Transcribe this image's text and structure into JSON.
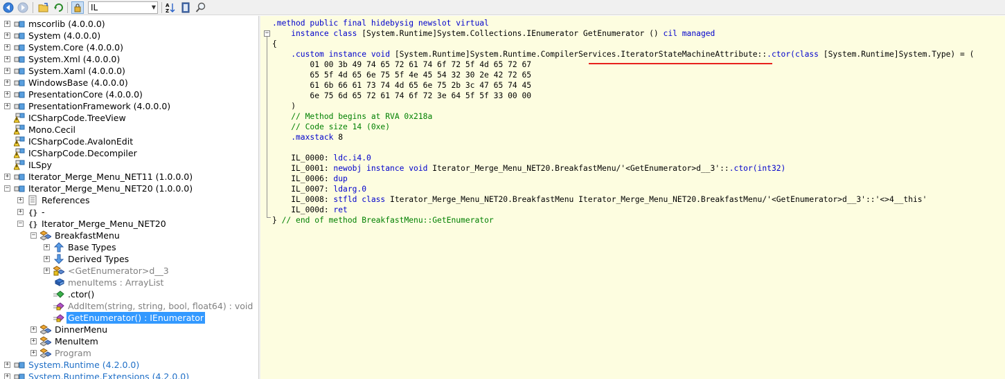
{
  "toolbar": {
    "language": "IL",
    "buttons": [
      "back-icon",
      "forward-icon",
      "open-file-icon",
      "reload-icon",
      "show-internal-icon",
      "sort-icon",
      "documentation-icon",
      "search-icon"
    ]
  },
  "tree": {
    "items": [
      {
        "label": "mscorlib (4.0.0.0)",
        "expander": "+",
        "icon": "assembly-icon",
        "style": "normal"
      },
      {
        "label": "System (4.0.0.0)",
        "expander": "+",
        "icon": "assembly-icon",
        "style": "normal"
      },
      {
        "label": "System.Core (4.0.0.0)",
        "expander": "+",
        "icon": "assembly-icon",
        "style": "normal"
      },
      {
        "label": "System.Xml (4.0.0.0)",
        "expander": "+",
        "icon": "assembly-icon",
        "style": "normal"
      },
      {
        "label": "System.Xaml (4.0.0.0)",
        "expander": "+",
        "icon": "assembly-icon",
        "style": "normal"
      },
      {
        "label": "WindowsBase (4.0.0.0)",
        "expander": "+",
        "icon": "assembly-icon",
        "style": "normal"
      },
      {
        "label": "PresentationCore (4.0.0.0)",
        "expander": "+",
        "icon": "assembly-icon",
        "style": "normal"
      },
      {
        "label": "PresentationFramework (4.0.0.0)",
        "expander": "+",
        "icon": "assembly-icon",
        "style": "normal"
      },
      {
        "label": "ICSharpCode.TreeView",
        "expander": "",
        "icon": "assembly-warning-icon",
        "style": "normal"
      },
      {
        "label": "Mono.Cecil",
        "expander": "",
        "icon": "assembly-warning-icon",
        "style": "normal"
      },
      {
        "label": "ICSharpCode.AvalonEdit",
        "expander": "",
        "icon": "assembly-warning-icon",
        "style": "normal"
      },
      {
        "label": "ICSharpCode.Decompiler",
        "expander": "",
        "icon": "assembly-warning-icon",
        "style": "normal"
      },
      {
        "label": "ILSpy",
        "expander": "",
        "icon": "assembly-warning-icon",
        "style": "normal"
      },
      {
        "label": "Iterator_Merge_Menu_NET11 (1.0.0.0)",
        "expander": "+",
        "icon": "assembly-icon",
        "style": "normal"
      },
      {
        "label": "Iterator_Merge_Menu_NET20 (1.0.0.0)",
        "expander": "-",
        "icon": "assembly-icon",
        "style": "normal"
      },
      {
        "label": "References",
        "expander": "+",
        "icon": "references-icon",
        "style": "normal"
      },
      {
        "label": "-",
        "expander": "+",
        "icon": "namespace-icon",
        "style": "normal"
      },
      {
        "label": "Iterator_Merge_Menu_NET20",
        "expander": "-",
        "icon": "namespace-icon",
        "style": "normal"
      },
      {
        "label": "BreakfastMenu",
        "expander": "-",
        "icon": "class-icon",
        "style": "normal"
      },
      {
        "label": "Base Types",
        "expander": "+",
        "icon": "base-types-icon",
        "style": "normal"
      },
      {
        "label": "Derived Types",
        "expander": "+",
        "icon": "derived-types-icon",
        "style": "normal"
      },
      {
        "label": "<GetEnumerator>d__3",
        "expander": "+",
        "icon": "nested-class-icon",
        "style": "gray"
      },
      {
        "label": "menuItems : ArrayList",
        "expander": "",
        "icon": "field-icon",
        "style": "gray"
      },
      {
        "label": ".ctor()",
        "expander": "",
        "icon": "method-icon",
        "style": "normal"
      },
      {
        "label": "AddItem(string, string, bool, float64) : void",
        "expander": "",
        "icon": "method-private-icon",
        "style": "gray"
      },
      {
        "label": "GetEnumerator() : IEnumerator",
        "expander": "",
        "icon": "method-private-icon",
        "style": "selected"
      },
      {
        "label": "DinnerMenu",
        "expander": "+",
        "icon": "class-icon",
        "style": "normal"
      },
      {
        "label": "MenuItem",
        "expander": "+",
        "icon": "class-icon",
        "style": "normal"
      },
      {
        "label": "Program",
        "expander": "+",
        "icon": "class-icon",
        "style": "gray"
      },
      {
        "label": "System.Runtime (4.2.0.0)",
        "expander": "+",
        "icon": "assembly-icon",
        "style": "blue"
      },
      {
        "label": "System.Runtime.Extensions (4.2.0.0)",
        "expander": "+",
        "icon": "assembly-icon",
        "style": "blue"
      }
    ]
  },
  "code": {
    "lines": [
      [
        {
          "t": ".method public final hidebysig newslot virtual",
          "k": "kw"
        }
      ],
      [
        {
          "t": "    instance class ",
          "k": "kw"
        },
        {
          "t": "[System.Runtime]System.Collections.IEnumerator GetEnumerator () ",
          "k": ""
        },
        {
          "t": "cil managed",
          "k": "kw"
        }
      ],
      [
        {
          "t": "{",
          "k": ""
        }
      ],
      [
        {
          "t": "    .custom instance void ",
          "k": "kw"
        },
        {
          "t": "[System.Runtime]System.Runtime.CompilerServices.IteratorStateMachineAttribute::",
          "k": ""
        },
        {
          "t": ".ctor(class ",
          "k": "kw"
        },
        {
          "t": "[System.Runtime]System.Type) = (",
          "k": ""
        }
      ],
      [
        {
          "t": "        01 00 3b 49 74 65 72 61 74 6f 72 5f 4d 65 72 67",
          "k": ""
        }
      ],
      [
        {
          "t": "        65 5f 4d 65 6e 75 5f 4e 45 54 32 30 2e 42 72 65",
          "k": ""
        }
      ],
      [
        {
          "t": "        61 6b 66 61 73 74 4d 65 6e 75 2b 3c 47 65 74 45",
          "k": ""
        }
      ],
      [
        {
          "t": "        6e 75 6d 65 72 61 74 6f 72 3e 64 5f 5f 33 00 00",
          "k": ""
        }
      ],
      [
        {
          "t": "    )",
          "k": ""
        }
      ],
      [
        {
          "t": "    // Method begins at RVA 0x218a",
          "k": "cm"
        }
      ],
      [
        {
          "t": "    // Code size 14 (0xe)",
          "k": "cm"
        }
      ],
      [
        {
          "t": "    .maxstack ",
          "k": "kw"
        },
        {
          "t": "8",
          "k": ""
        }
      ],
      [
        {
          "t": "",
          "k": ""
        }
      ],
      [
        {
          "t": "    IL_0000: ",
          "k": ""
        },
        {
          "t": "ldc.i4.0",
          "k": "kw"
        }
      ],
      [
        {
          "t": "    IL_0001: ",
          "k": ""
        },
        {
          "t": "newobj instance void ",
          "k": "kw"
        },
        {
          "t": "Iterator_Merge_Menu_NET20.BreakfastMenu/'<GetEnumerator>d__3'::",
          "k": ""
        },
        {
          "t": ".ctor(int32)",
          "k": "kw"
        }
      ],
      [
        {
          "t": "    IL_0006: ",
          "k": ""
        },
        {
          "t": "dup",
          "k": "kw"
        }
      ],
      [
        {
          "t": "    IL_0007: ",
          "k": ""
        },
        {
          "t": "ldarg.0",
          "k": "kw"
        }
      ],
      [
        {
          "t": "    IL_0008: ",
          "k": ""
        },
        {
          "t": "stfld class ",
          "k": "kw"
        },
        {
          "t": "Iterator_Merge_Menu_NET20.BreakfastMenu Iterator_Merge_Menu_NET20.BreakfastMenu/'<GetEnumerator>d__3'::'<>4__this'",
          "k": ""
        }
      ],
      [
        {
          "t": "    IL_000d: ",
          "k": ""
        },
        {
          "t": "ret",
          "k": "kw"
        }
      ],
      [
        {
          "t": "} ",
          "k": ""
        },
        {
          "t": "// end of method BreakfastMenu::GetEnumerator",
          "k": "cm"
        }
      ]
    ]
  }
}
